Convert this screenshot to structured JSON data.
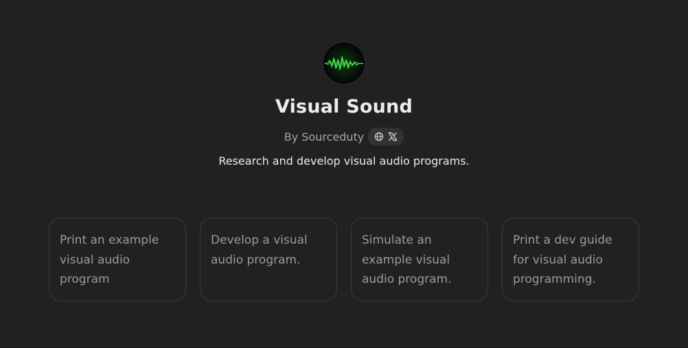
{
  "gpt": {
    "title": "Visual Sound",
    "author": "By Sourceduty",
    "description": "Research and develop visual audio programs."
  },
  "icons": {
    "avatar": "green-waveform-logo",
    "website": "globe-icon",
    "social": "x-icon"
  },
  "starters": [
    "Print an example visual audio program",
    "Develop a visual audio program.",
    "Simulate an example visual audio program.",
    "Print a dev guide for visual audio programming."
  ],
  "colors": {
    "background": "#212121",
    "title": "#ececec",
    "muted": "#a6a6a6",
    "card_border": "#3b3b3b",
    "accent_green": "#39ff3a"
  }
}
